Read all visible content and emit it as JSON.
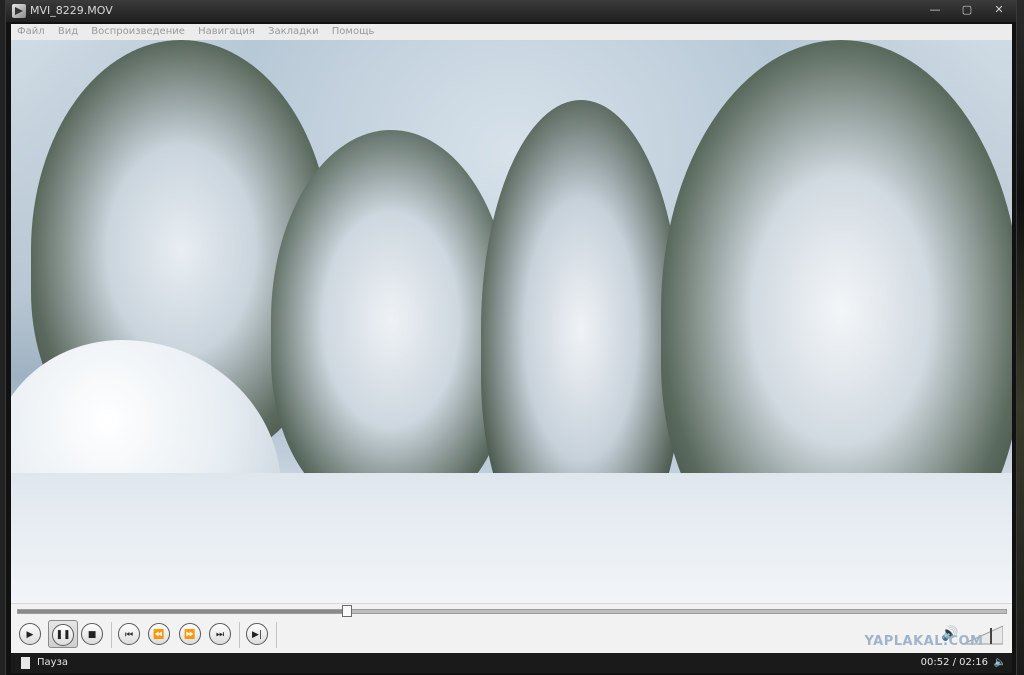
{
  "window": {
    "title": "MVI_8229.MOV",
    "controls": {
      "minimize": "—",
      "maximize": "▢",
      "close": "✕"
    }
  },
  "menu": {
    "items": [
      "Файл",
      "Вид",
      "Воспроизведение",
      "Навигация",
      "Закладки",
      "Помощь"
    ]
  },
  "player": {
    "progress": 0.3333,
    "buttons": {
      "play": "▶",
      "pause": "❚❚",
      "stop": "■",
      "prev": "⏮",
      "rewind": "⏪",
      "forward": "⏩",
      "next": "⏭",
      "frame_step": "▶|"
    }
  },
  "watermark": "YAPLAKAL.COM",
  "status": {
    "state": "Пауза",
    "time": "00:52 / 02:16"
  },
  "colors": {
    "sky": "#c8d6e1",
    "snow": "#f1f4f6",
    "tree_dark": "#3a4a3c"
  }
}
